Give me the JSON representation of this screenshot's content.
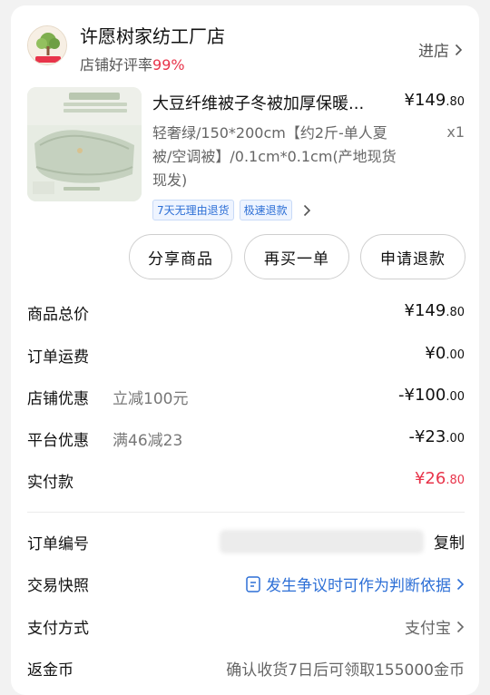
{
  "shop": {
    "name": "许愿树家纺工厂店",
    "rating_label": "店铺好评率",
    "rating_value": "99%",
    "enter_label": "进店"
  },
  "product": {
    "title": "大豆纤维被子冬被加厚保暖...",
    "price_main": "¥149",
    "price_decimal": ".80",
    "spec": "轻奢绿/150*200cm【约2斤-单人夏被/空调被】/0.1cm*0.1cm(产地现货现发)",
    "quantity": "x1",
    "tags": [
      "7天无理由退货",
      "极速退款"
    ]
  },
  "actions": {
    "share": "分享商品",
    "rebuy": "再买一单",
    "refund": "申请退款"
  },
  "pricing": {
    "total_label": "商品总价",
    "total_main": "¥149",
    "total_decimal": ".80",
    "shipping_label": "订单运费",
    "shipping_main": "¥0",
    "shipping_decimal": ".00",
    "shop_discount_label": "店铺优惠",
    "shop_discount_desc": "立减100元",
    "shop_discount_main": "-¥100",
    "shop_discount_decimal": ".00",
    "platform_discount_label": "平台优惠",
    "platform_discount_desc": "满46减23",
    "platform_discount_main": "-¥23",
    "platform_discount_decimal": ".00",
    "paid_label": "实付款",
    "paid_main": "¥26",
    "paid_decimal": ".80"
  },
  "order": {
    "number_label": "订单编号",
    "copy_label": "复制",
    "snapshot_label": "交易快照",
    "snapshot_text": "发生争议时可作为判断依据",
    "payment_label": "支付方式",
    "payment_value": "支付宝",
    "coins_label": "返金币",
    "coins_text": "确认收货7日后可领取155000金币"
  },
  "colors": {
    "accent_red": "#e8344a",
    "link_blue": "#2d6fd6",
    "background": "#f2f2f2"
  }
}
